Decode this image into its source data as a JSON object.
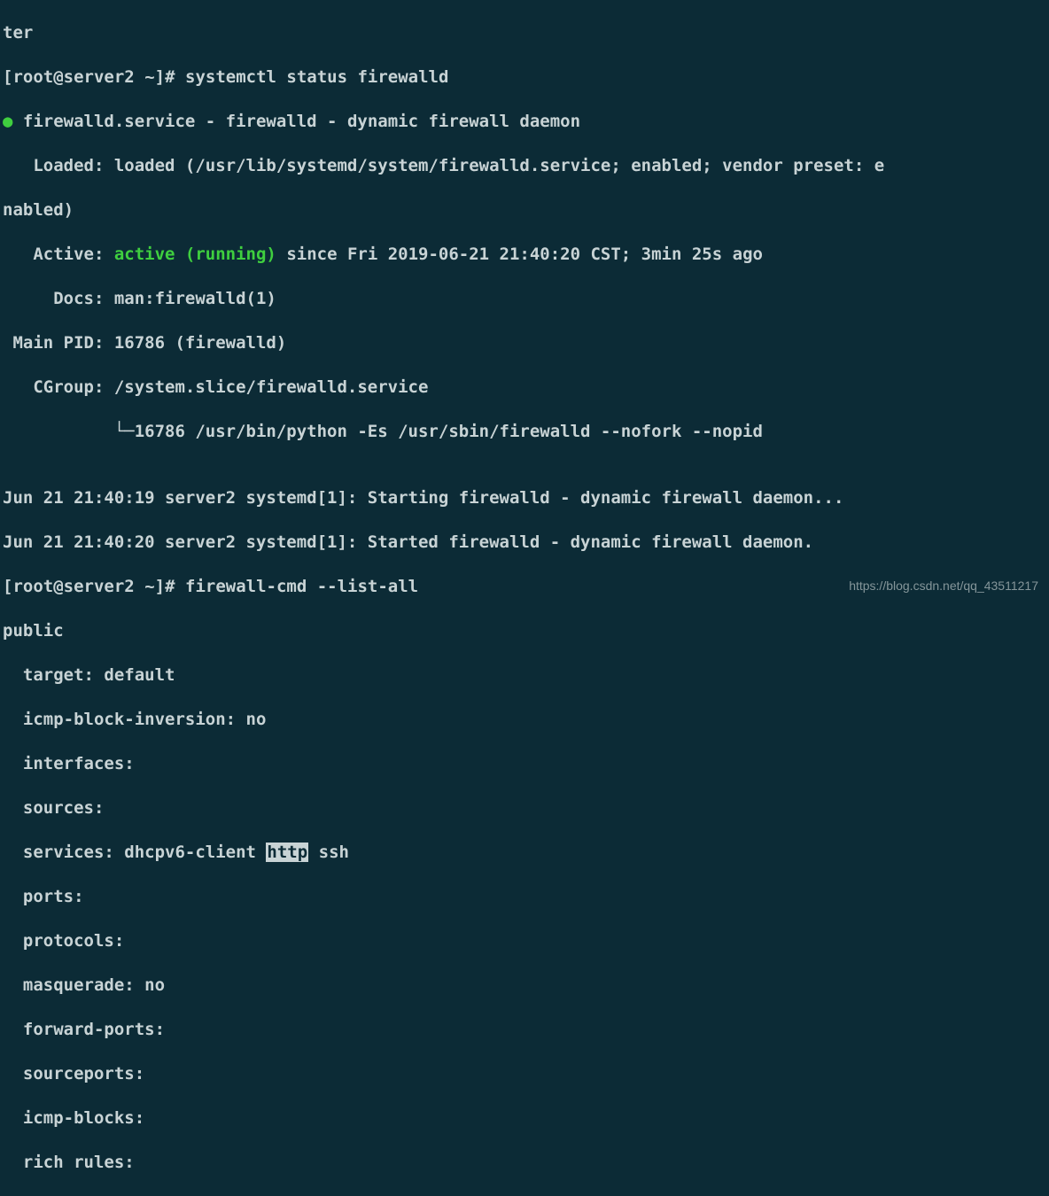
{
  "lines": {
    "l0": "ter",
    "prompt1_open": "[",
    "prompt1_user": "root",
    "prompt1_at": "@",
    "prompt1_host": "server2",
    "prompt1_space": " ",
    "prompt1_path": "~",
    "prompt1_close": "]",
    "prompt1_hash": "#",
    "cmd1": " systemctl status firewalld",
    "bullet": "●",
    "service_header": " firewalld.service - firewalld - dynamic firewall daemon",
    "loaded": "   Loaded: loaded (/usr/lib/systemd/system/firewalld.service; enabled; vendor preset: e",
    "loaded2": "nabled)",
    "active_label": "   Active: ",
    "active_value": "active (running)",
    "active_since": " since Fri 2019-06-21 21:40:20 CST; 3min 25s ago",
    "docs": "     Docs: man:firewalld(1)",
    "mainpid": " Main PID: 16786 (firewalld)",
    "cgroup": "   CGroup: /system.slice/firewalld.service",
    "tree": "           └─16786 /usr/bin/python -Es /usr/sbin/firewalld --nofork --nopid",
    "empty": "",
    "log1": "Jun 21 21:40:19 server2 systemd[1]: Starting firewalld - dynamic firewall daemon...",
    "log2": "Jun 21 21:40:20 server2 systemd[1]: Started firewalld - dynamic firewall daemon.",
    "prompt2_open": "[",
    "prompt2_user": "root",
    "prompt2_at": "@",
    "prompt2_host": "server2",
    "prompt2_space": " ",
    "prompt2_path": "~",
    "prompt2_close": "]",
    "prompt2_hash": "#",
    "cmd2": " firewall-cmd --list-all",
    "public": "public",
    "target": "  target: default",
    "icmpinv": "  icmp-block-inversion: no",
    "interfaces": "  interfaces:",
    "sources": "  sources:",
    "services_pre": "  services: dhcpv6-client ",
    "services_http": "http",
    "services_post": " ssh",
    "ports": "  ports:",
    "protocols": "  protocols:",
    "masquerade": "  masquerade: no",
    "forward": "  forward-ports:",
    "sourceports": "  sourceports:",
    "icmpblocks": "  icmp-blocks:",
    "rich": "  rich rules:"
  },
  "watermark": "https://blog.csdn.net/qq_43511217"
}
